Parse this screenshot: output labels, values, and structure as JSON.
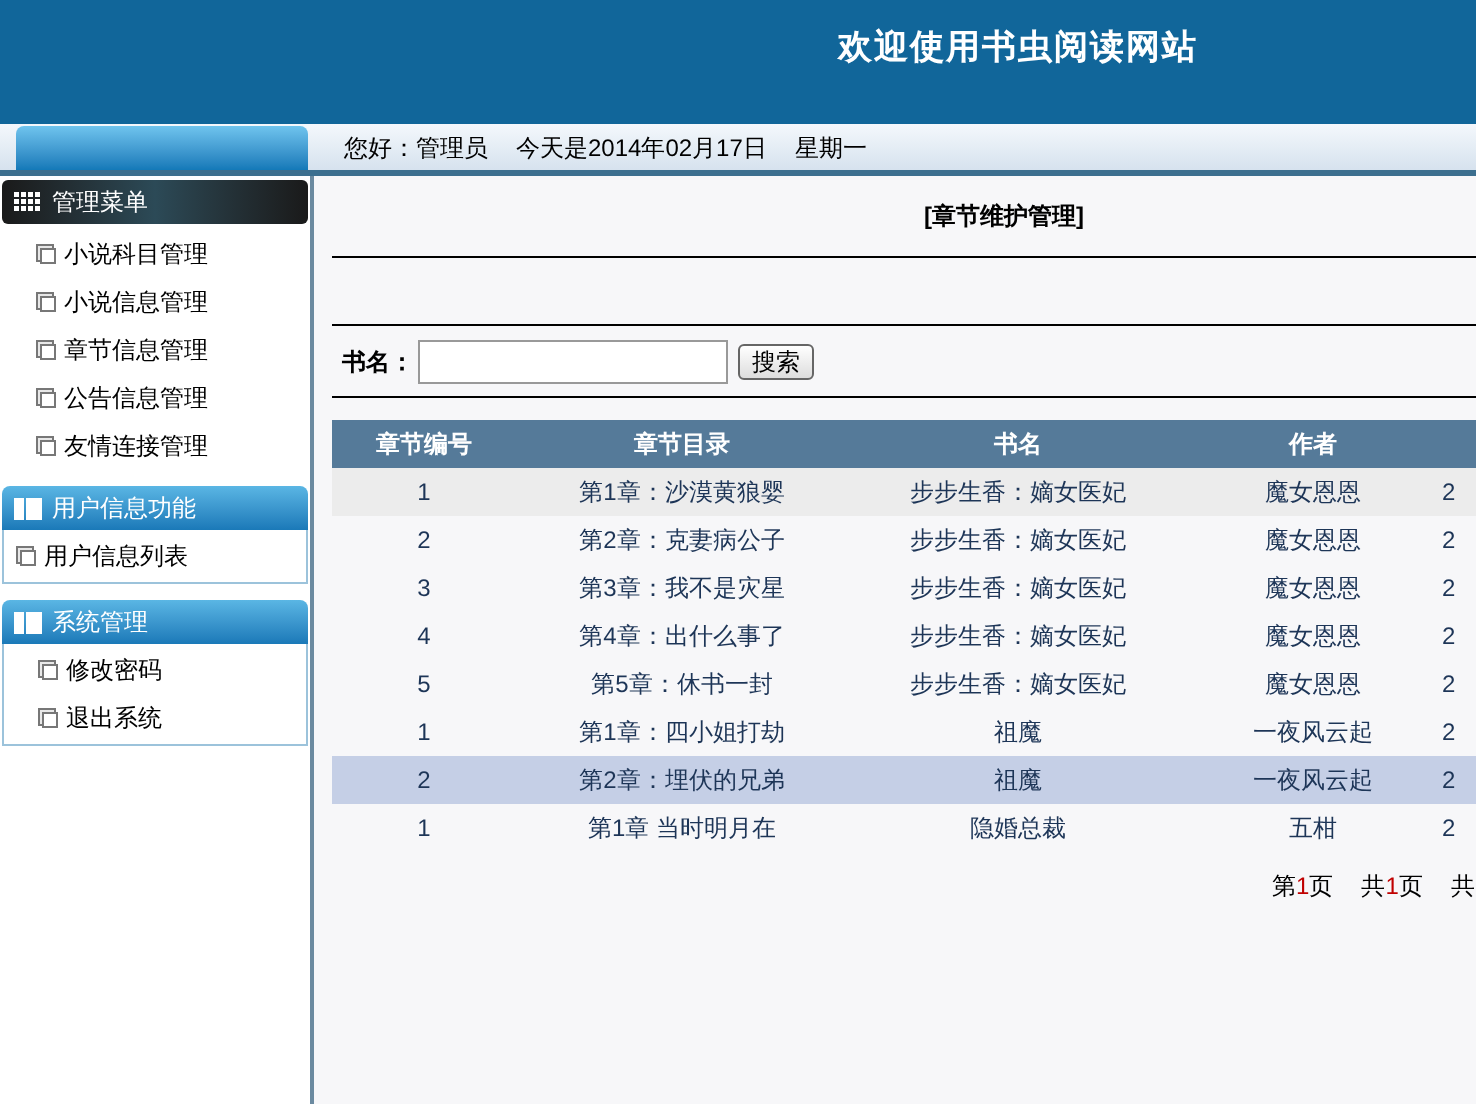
{
  "header": {
    "title": "欢迎使用书虫阅读网站"
  },
  "top_bar": {
    "greeting": "您好：管理员",
    "date": "今天是2014年02月17日",
    "weekday": "星期一"
  },
  "sidebar": {
    "sections": [
      {
        "title": "管理菜单",
        "kind": "dark",
        "items": [
          "小说科目管理",
          "小说信息管理",
          "章节信息管理",
          "公告信息管理",
          "友情连接管理"
        ]
      },
      {
        "title": "用户信息功能",
        "kind": "blue",
        "items": [
          "用户信息列表"
        ]
      },
      {
        "title": "系统管理",
        "kind": "blue",
        "items": [
          "修改密码",
          "退出系统"
        ]
      }
    ]
  },
  "page": {
    "title": "[章节维护管理]",
    "search": {
      "label": "书名：",
      "button": "搜索"
    },
    "table": {
      "columns": [
        "章节编号",
        "章节目录",
        "书名",
        "作者"
      ],
      "rows": [
        {
          "cells": [
            "1",
            "第1章：沙漠黄狼婴",
            "步步生香：嫡女医妃",
            "魔女恩恩",
            "2"
          ],
          "shaded": true,
          "selected": false
        },
        {
          "cells": [
            "2",
            "第2章：克妻病公子",
            "步步生香：嫡女医妃",
            "魔女恩恩",
            "2"
          ],
          "shaded": false,
          "selected": false
        },
        {
          "cells": [
            "3",
            "第3章：我不是灾星",
            "步步生香：嫡女医妃",
            "魔女恩恩",
            "2"
          ],
          "shaded": false,
          "selected": false
        },
        {
          "cells": [
            "4",
            "第4章：出什么事了",
            "步步生香：嫡女医妃",
            "魔女恩恩",
            "2"
          ],
          "shaded": false,
          "selected": false
        },
        {
          "cells": [
            "5",
            "第5章：休书一封",
            "步步生香：嫡女医妃",
            "魔女恩恩",
            "2"
          ],
          "shaded": false,
          "selected": false
        },
        {
          "cells": [
            "1",
            "第1章：四小姐打劫",
            "祖魔",
            "一夜风云起",
            "2"
          ],
          "shaded": false,
          "selected": false
        },
        {
          "cells": [
            "2",
            "第2章：埋伏的兄弟",
            "祖魔",
            "一夜风云起",
            "2"
          ],
          "shaded": false,
          "selected": true
        },
        {
          "cells": [
            "1",
            "第1章 当时明月在",
            "隐婚总裁",
            "五柑",
            "2"
          ],
          "shaded": false,
          "selected": false
        }
      ]
    },
    "pagination": [
      {
        "parts": [
          {
            "kind": "text",
            "text": "第"
          },
          {
            "kind": "number",
            "text": "1"
          },
          {
            "kind": "text",
            "text": "页"
          }
        ]
      },
      {
        "parts": [
          {
            "kind": "text",
            "text": "共"
          },
          {
            "kind": "number",
            "text": "1"
          },
          {
            "kind": "text",
            "text": "页"
          }
        ]
      },
      {
        "parts": [
          {
            "kind": "text",
            "text": "共"
          }
        ]
      }
    ]
  }
}
